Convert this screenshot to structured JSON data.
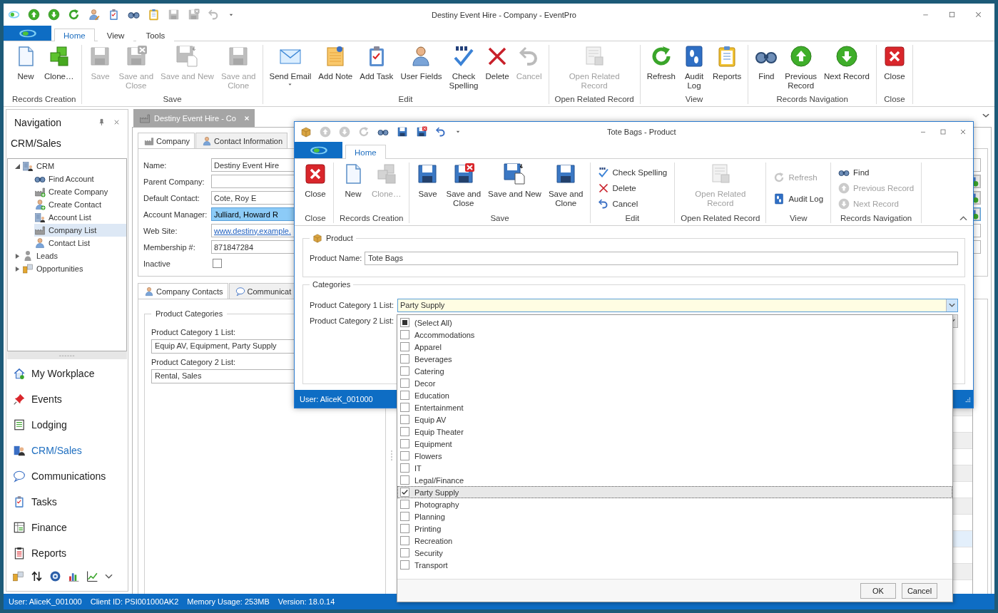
{
  "window": {
    "title": "Destiny Event Hire - Company - EventPro"
  },
  "ribbon": {
    "tabs": [
      {
        "label": "Home",
        "selected": true
      },
      {
        "label": "View",
        "selected": false
      },
      {
        "label": "Tools",
        "selected": false
      }
    ],
    "groups": [
      {
        "label": "Records Creation",
        "kind": "large",
        "buttons": [
          {
            "label": "New",
            "disabled": false
          },
          {
            "label": "Clone…",
            "disabled": false
          }
        ]
      },
      {
        "label": "Save",
        "kind": "large",
        "buttons": [
          {
            "label": "Save",
            "disabled": true
          },
          {
            "label": "Save and\nClose",
            "disabled": true
          },
          {
            "label": "Save and New",
            "disabled": true
          },
          {
            "label": "Save and\nClone",
            "disabled": true
          }
        ]
      },
      {
        "label": "Edit",
        "kind": "large",
        "buttons": [
          {
            "label": "Send Email",
            "disabled": false,
            "menu": true
          },
          {
            "label": "Add Note",
            "disabled": false
          },
          {
            "label": "Add Task",
            "disabled": false
          },
          {
            "label": "User Fields",
            "disabled": false
          },
          {
            "label": "Check\nSpelling",
            "disabled": false
          },
          {
            "label": "Delete",
            "disabled": false
          },
          {
            "label": "Cancel",
            "disabled": true
          }
        ]
      },
      {
        "label": "Open Related Record",
        "kind": "large",
        "buttons": [
          {
            "label": "Open Related\nRecord",
            "disabled": true
          }
        ]
      },
      {
        "label": "View",
        "kind": "large",
        "buttons": [
          {
            "label": "Refresh",
            "disabled": false
          },
          {
            "label": "Audit\nLog",
            "disabled": false
          },
          {
            "label": "Reports",
            "disabled": false
          }
        ]
      },
      {
        "label": "Records Navigation",
        "kind": "large",
        "buttons": [
          {
            "label": "Find",
            "disabled": false
          },
          {
            "label": "Previous\nRecord",
            "disabled": false
          },
          {
            "label": "Next Record",
            "disabled": false
          }
        ]
      },
      {
        "label": "Close",
        "kind": "large",
        "buttons": [
          {
            "label": "Close",
            "disabled": false
          }
        ]
      }
    ]
  },
  "navigation": {
    "title": "Navigation",
    "section": "CRM/Sales",
    "tree": [
      {
        "label": "CRM",
        "expanded": true,
        "selected": false,
        "children": [
          {
            "label": "Find Account",
            "selected": false
          },
          {
            "label": "Create Company",
            "selected": false
          },
          {
            "label": "Create Contact",
            "selected": false
          },
          {
            "label": "Account List",
            "selected": false
          },
          {
            "label": "Company List",
            "selected": true
          },
          {
            "label": "Contact List",
            "selected": false
          }
        ]
      },
      {
        "label": "Leads",
        "expanded": false,
        "selected": false
      },
      {
        "label": "Opportunities",
        "expanded": false,
        "selected": false
      }
    ],
    "modules": [
      {
        "label": "My Workplace",
        "selected": false
      },
      {
        "label": "Events",
        "selected": false
      },
      {
        "label": "Lodging",
        "selected": false
      },
      {
        "label": "CRM/Sales",
        "selected": true
      },
      {
        "label": "Communications",
        "selected": false
      },
      {
        "label": "Tasks",
        "selected": false
      },
      {
        "label": "Finance",
        "selected": false
      },
      {
        "label": "Reports",
        "selected": false
      }
    ]
  },
  "document": {
    "tabs": [
      {
        "label": "Destiny Event Hire - Co",
        "selected": true
      }
    ],
    "form_tabs": [
      {
        "label": "Company",
        "selected": true
      },
      {
        "label": "Contact Information",
        "selected": false
      }
    ],
    "fields": [
      {
        "label": "Name:",
        "kind": "text",
        "value": "Destiny Event Hire",
        "selected": false
      },
      {
        "label": "Parent Company:",
        "kind": "lookup",
        "selected": false
      },
      {
        "label": "Default Contact:",
        "kind": "lookup",
        "value": "Cote, Roy E",
        "selected": false
      },
      {
        "label": "Account Manager:",
        "kind": "lookup",
        "value": "Julliard, Howard R",
        "selected": true
      },
      {
        "label": "Web Site:",
        "kind": "link",
        "value": "www.destiny.example.",
        "selected": false
      },
      {
        "label": "Membership #:",
        "kind": "text",
        "value": "871847284",
        "selected": false
      },
      {
        "label": "Inactive",
        "kind": "checkbox",
        "checked": false,
        "selected": false
      }
    ],
    "detail_tabs": [
      {
        "label": "Company Contacts",
        "selected": true
      },
      {
        "label": "Communicat",
        "selected": false
      }
    ],
    "product_categories": {
      "title": "Product Categories",
      "fields": [
        {
          "label": "Product Category 1 List:",
          "value": "Equip AV, Equipment, Party Supply"
        },
        {
          "label": "Product Category 2 List:",
          "value": "Rental, Sales"
        }
      ]
    }
  },
  "status_bar": {
    "items": [
      "User: AliceK_001000",
      "Client ID: PSI001000AK2",
      "Memory Usage: 253MB",
      "Version: 18.0.14"
    ]
  },
  "dialog": {
    "title": "Tote Bags - Product",
    "ribbon": {
      "tabs": [
        {
          "label": "Home",
          "selected": true
        }
      ],
      "groups": [
        {
          "label": "Close",
          "kind": "large",
          "buttons": [
            {
              "label": "Close",
              "disabled": false
            }
          ]
        },
        {
          "label": "Records Creation",
          "kind": "large",
          "buttons": [
            {
              "label": "New",
              "disabled": false
            },
            {
              "label": "Clone…",
              "disabled": true
            }
          ]
        },
        {
          "label": "Save",
          "kind": "large",
          "buttons": [
            {
              "label": "Save",
              "disabled": false
            },
            {
              "label": "Save and\nClose",
              "disabled": false
            },
            {
              "label": "Save and New",
              "disabled": false
            },
            {
              "label": "Save and\nClone",
              "disabled": false
            }
          ]
        },
        {
          "label": "Edit",
          "kind": "small",
          "buttons": [
            {
              "label": "Check Spelling",
              "disabled": false
            },
            {
              "label": "Delete",
              "disabled": false
            },
            {
              "label": "Cancel",
              "disabled": false
            }
          ]
        },
        {
          "label": "Open Related Record",
          "kind": "large",
          "buttons": [
            {
              "label": "Open Related\nRecord",
              "disabled": true
            }
          ]
        },
        {
          "label": "View",
          "kind": "small",
          "buttons": [
            {
              "label": "Refresh",
              "disabled": true
            },
            {
              "label": "Audit Log",
              "disabled": false
            }
          ]
        },
        {
          "label": "Records Navigation",
          "kind": "small",
          "buttons": [
            {
              "label": "Find",
              "disabled": false
            },
            {
              "label": "Previous Record",
              "disabled": true
            },
            {
              "label": "Next Record",
              "disabled": true
            }
          ]
        }
      ]
    },
    "product": {
      "title": "Product",
      "fields": [
        {
          "label": "Product Name:",
          "value": "Tote Bags"
        }
      ]
    },
    "categories": {
      "title": "Categories",
      "fields": [
        {
          "label": "Product Category 1 List:",
          "value": "Party Supply",
          "focused": true
        },
        {
          "label": "Product Category 2 List:",
          "focused": false
        }
      ]
    },
    "status": "User: AliceK_001000"
  },
  "dropdown": {
    "items": [
      {
        "label": "(Select All)",
        "checked": false,
        "indeterminate": true,
        "selected": false
      },
      {
        "label": "Accommodations",
        "checked": false,
        "indeterminate": false,
        "selected": false
      },
      {
        "label": "Apparel",
        "checked": false,
        "indeterminate": false,
        "selected": false
      },
      {
        "label": "Beverages",
        "checked": false,
        "indeterminate": false,
        "selected": false
      },
      {
        "label": "Catering",
        "checked": false,
        "indeterminate": false,
        "selected": false
      },
      {
        "label": "Decor",
        "checked": false,
        "indeterminate": false,
        "selected": false
      },
      {
        "label": "Education",
        "checked": false,
        "indeterminate": false,
        "selected": false
      },
      {
        "label": "Entertainment",
        "checked": false,
        "indeterminate": false,
        "selected": false
      },
      {
        "label": "Equip AV",
        "checked": false,
        "indeterminate": false,
        "selected": false
      },
      {
        "label": "Equip Theater",
        "checked": false,
        "indeterminate": false,
        "selected": false
      },
      {
        "label": "Equipment",
        "checked": false,
        "indeterminate": false,
        "selected": false
      },
      {
        "label": "Flowers",
        "checked": false,
        "indeterminate": false,
        "selected": false
      },
      {
        "label": "IT",
        "checked": false,
        "indeterminate": false,
        "selected": false
      },
      {
        "label": "Legal/Finance",
        "checked": false,
        "indeterminate": false,
        "selected": false
      },
      {
        "label": "Party Supply",
        "checked": true,
        "indeterminate": false,
        "selected": true
      },
      {
        "label": "Photography",
        "checked": false,
        "indeterminate": false,
        "selected": false
      },
      {
        "label": "Planning",
        "checked": false,
        "indeterminate": false,
        "selected": false
      },
      {
        "label": "Printing",
        "checked": false,
        "indeterminate": false,
        "selected": false
      },
      {
        "label": "Recreation",
        "checked": false,
        "indeterminate": false,
        "selected": false
      },
      {
        "label": "Security",
        "checked": false,
        "indeterminate": false,
        "selected": false
      },
      {
        "label": "Transport",
        "checked": false,
        "indeterminate": false,
        "selected": false
      }
    ],
    "buttons": [
      "OK",
      "Cancel"
    ]
  }
}
